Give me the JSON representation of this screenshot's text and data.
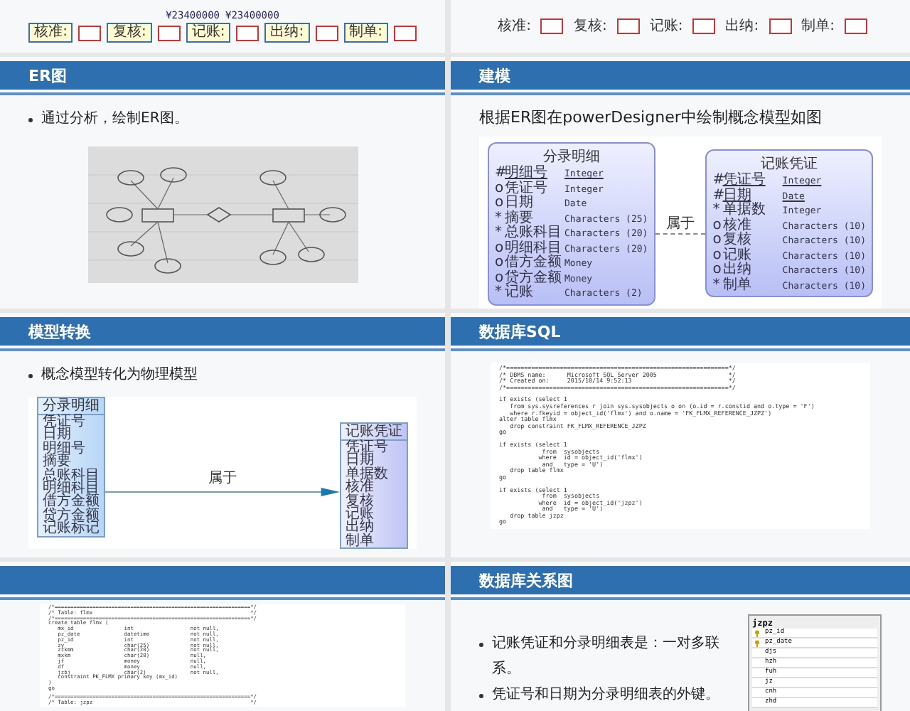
{
  "top_strips": [
    {
      "amounts": [
        "¥23400000",
        "¥23400000"
      ],
      "labels": [
        {
          "text": "核准:",
          "boxed": true
        },
        {
          "text": "复核:",
          "boxed": true
        },
        {
          "text": "记账:",
          "boxed": true
        },
        {
          "text": "出纳:",
          "boxed": true
        },
        {
          "text": "制单:",
          "boxed": true
        }
      ]
    },
    {
      "labels": [
        {
          "text": "核准:",
          "boxed": false
        },
        {
          "text": "复核:",
          "boxed": false
        },
        {
          "text": "记账:",
          "boxed": false
        },
        {
          "text": "出纳:",
          "boxed": false
        },
        {
          "text": "制单:",
          "boxed": false
        }
      ]
    }
  ],
  "slides": [
    {
      "title": "ER图",
      "bullets": [
        "通过分析，绘制ER图。"
      ],
      "content": {
        "kind": "picture"
      }
    },
    {
      "title": "建模",
      "lead": "根据ER图在powerDesigner中绘制概念模型如图",
      "content": {
        "kind": "conceptual",
        "relation": "属于",
        "entities": [
          {
            "name": "分录明细",
            "attributes": [
              {
                "marker": "#",
                "name": "明细号",
                "type": "Integer",
                "key": true
              },
              {
                "marker": "o",
                "name": "凭证号",
                "type": "Integer",
                "key": false
              },
              {
                "marker": "o",
                "name": "日期",
                "type": "Date",
                "key": false
              },
              {
                "marker": "*",
                "name": "摘要",
                "type": "Characters (25)",
                "key": false
              },
              {
                "marker": "*",
                "name": "总账科目",
                "type": "Characters (20)",
                "key": false
              },
              {
                "marker": "o",
                "name": "明细科目",
                "type": "Characters (20)",
                "key": false
              },
              {
                "marker": "o",
                "name": "借方金额",
                "type": "Money",
                "key": false
              },
              {
                "marker": "o",
                "name": "贷方金额",
                "type": "Money",
                "key": false
              },
              {
                "marker": "*",
                "name": "记账",
                "type": "Characters (2)",
                "key": false
              }
            ]
          },
          {
            "name": "记账凭证",
            "attributes": [
              {
                "marker": "#",
                "name": "凭证号",
                "type": "Integer",
                "key": true
              },
              {
                "marker": "#",
                "name": "日期",
                "type": "Date",
                "key": true
              },
              {
                "marker": "*",
                "name": "单据数",
                "type": "Integer",
                "key": false
              },
              {
                "marker": "o",
                "name": "核准",
                "type": "Characters (10)",
                "key": false
              },
              {
                "marker": "o",
                "name": "复核",
                "type": "Characters (10)",
                "key": false
              },
              {
                "marker": "o",
                "name": "记账",
                "type": "Characters (10)",
                "key": false
              },
              {
                "marker": "o",
                "name": "出纳",
                "type": "Characters (10)",
                "key": false
              },
              {
                "marker": "*",
                "name": "制单",
                "type": "Characters (10)",
                "key": false
              }
            ]
          }
        ]
      }
    },
    {
      "title": "模型转换",
      "bullets": [
        "概念模型转化为物理模型"
      ],
      "content": {
        "kind": "physical",
        "relation": "属于",
        "tables": [
          {
            "name": "分录明细",
            "columns": [
              "凭证号",
              "日期",
              "明细号",
              "摘要",
              "总账科目",
              "明细科目",
              "借方金额",
              "贷方金额",
              "记账标记"
            ]
          },
          {
            "name": "记账凭证",
            "columns": [
              "凭证号",
              "日期",
              "单据数",
              "核准",
              "复核",
              "记账",
              "出纳",
              "制单"
            ]
          }
        ]
      }
    },
    {
      "title": "数据库SQL",
      "content": {
        "kind": "code",
        "blocks": [
          [
            "/*==============================================================*/",
            "/* DBMS name:      Microsoft SQL Server 2005                    */",
            "/* Created on:     2015/10/14 9:52:13                           */",
            "/*==============================================================*/"
          ],
          [
            "if exists (select 1",
            "   from sys.sysreferences r join sys.sysobjects o on (o.id = r.constid and o.type = 'F')",
            "   where r.fkeyid = object_id('flmx') and o.name = 'FK_FLMX_REFERENCE_JZPZ')",
            "alter table flmx",
            "   drop constraint FK_FLMX_REFERENCE_JZPZ",
            "go"
          ],
          [
            "if exists (select 1",
            "            from  sysobjects",
            "           where  id = object_id('flmx')",
            "            and   type = 'U')",
            "   drop table flmx",
            "go"
          ],
          [
            "if exists (select 1",
            "            from  sysobjects",
            "           where  id = object_id('jzpz')",
            "            and   type = 'U')",
            "   drop table jzpz",
            "go"
          ]
        ]
      }
    },
    {
      "content": {
        "kind": "code",
        "blocks": [
          [
            "/*==============================================================*/",
            "/* Table: flmx                                                  */",
            "/*==============================================================*/",
            "create table flmx (",
            "   mx_id                int                  not null,",
            "   pz_date              datetime             not null,",
            "   pz_id                int                  not null,",
            "   zy                   char(25)             not null,",
            "   zzkmm                char(20)             not null,",
            "   mxkm                 char(20)             null,",
            "   jf                   money                null,",
            "   df                   money                null,",
            "   jzbj                 char(2)              not null,",
            "   constraint PK_FLMX primary key (mx_id)",
            ")",
            "go"
          ],
          [
            "/*==============================================================*/",
            "/* Table: jzpz                                                  */"
          ]
        ]
      }
    },
    {
      "title": "数据库关系图",
      "bullets": [
        "记账凭证和分录明细表是：一对多联系。",
        "凭证号和日期为分录明细表的外键。"
      ],
      "content": {
        "kind": "relation_table",
        "table": {
          "name": "jzpz",
          "columns": [
            {
              "name": "pz_id",
              "key": true
            },
            {
              "name": "pz_date",
              "key": true
            },
            {
              "name": "djs",
              "key": false
            },
            {
              "name": "hzh",
              "key": false
            },
            {
              "name": "fuh",
              "key": false
            },
            {
              "name": "jz",
              "key": false
            },
            {
              "name": "cnh",
              "key": false
            },
            {
              "name": "zhd",
              "key": false
            }
          ]
        }
      }
    }
  ]
}
